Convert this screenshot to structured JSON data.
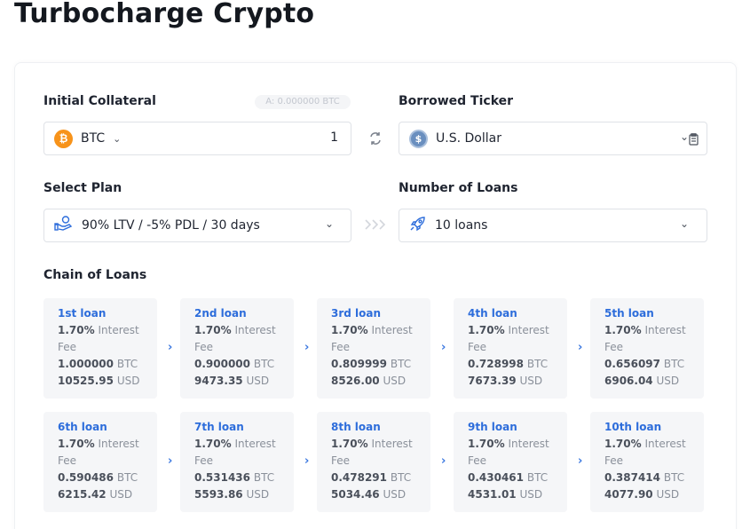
{
  "page_title": "Turbocharge Crypto",
  "collateral": {
    "label": "Initial Collateral",
    "balance": "A: 0.000000 BTC",
    "coin_symbol": "₿",
    "coin_name": "BTC",
    "amount": "1"
  },
  "borrowed": {
    "label": "Borrowed Ticker",
    "coin_symbol": "$",
    "coin_name": "U.S. Dollar"
  },
  "plan": {
    "label": "Select Plan",
    "value": "90% LTV / -5% PDL / 30 days"
  },
  "loans_count": {
    "label": "Number of Loans",
    "value": "10 loans"
  },
  "chain": {
    "label": "Chain of Loans",
    "interest_suffix": "Interest",
    "fee_label": "Fee",
    "loans": [
      {
        "title": "1st loan",
        "rate": "1.70%",
        "btc": "1.000000",
        "usd": "10525.95"
      },
      {
        "title": "2nd loan",
        "rate": "1.70%",
        "btc": "0.900000",
        "usd": "9473.35"
      },
      {
        "title": "3rd loan",
        "rate": "1.70%",
        "btc": "0.809999",
        "usd": "8526.00"
      },
      {
        "title": "4th loan",
        "rate": "1.70%",
        "btc": "0.728998",
        "usd": "7673.39"
      },
      {
        "title": "5th loan",
        "rate": "1.70%",
        "btc": "0.656097",
        "usd": "6906.04"
      },
      {
        "title": "6th loan",
        "rate": "1.70%",
        "btc": "0.590486",
        "usd": "6215.42"
      },
      {
        "title": "7th loan",
        "rate": "1.70%",
        "btc": "0.531436",
        "usd": "5593.86"
      },
      {
        "title": "8th loan",
        "rate": "1.70%",
        "btc": "0.478291",
        "usd": "5034.46"
      },
      {
        "title": "9th loan",
        "rate": "1.70%",
        "btc": "0.430461",
        "usd": "4531.01"
      },
      {
        "title": "10th loan",
        "rate": "1.70%",
        "btc": "0.387414",
        "usd": "4077.90"
      }
    ],
    "btc_unit": "BTC",
    "usd_unit": "USD"
  }
}
